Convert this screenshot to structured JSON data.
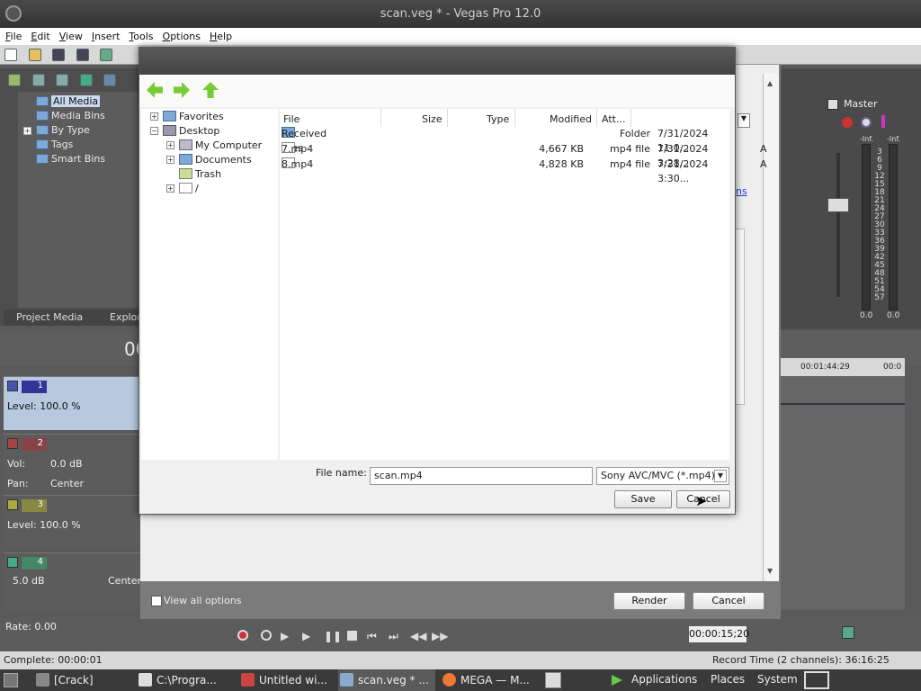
{
  "window": {
    "title": "scan.veg * - Vegas Pro 12.0"
  },
  "menu": [
    "File",
    "Edit",
    "View",
    "Insert",
    "Tools",
    "Options",
    "Help"
  ],
  "media_tree": [
    "All Media",
    "Media Bins",
    "By Type",
    "Tags",
    "Smart Bins"
  ],
  "media_tabs": [
    "Project Media",
    "Explorer"
  ],
  "master": {
    "label": "Master",
    "left_top": "-Inf.",
    "right_top": "-Inf.",
    "left_val": "0.0",
    "right_val": "0.0",
    "ticks": [
      "3",
      "6",
      "9",
      "12",
      "15",
      "18",
      "21",
      "24",
      "27",
      "30",
      "33",
      "36",
      "39",
      "42",
      "45",
      "48",
      "51",
      "54",
      "57"
    ]
  },
  "timeline": {
    "cursor_partial": "00",
    "ruler": [
      "00:01:44:29",
      "00:0"
    ]
  },
  "tracks": [
    {
      "num": "1",
      "line1": "Level: 100.0 %"
    },
    {
      "num": "2",
      "vol_label": "Vol:",
      "vol": "0.0 dB",
      "pan_label": "Pan:",
      "pan": "Center"
    },
    {
      "num": "3",
      "line1": "Level: 100.0 %"
    },
    {
      "num": "4",
      "vol": "5.0 dB",
      "pan": "Center"
    }
  ],
  "transport": {
    "rate": "Rate: 0.00",
    "time": "00:00:15;20"
  },
  "status": {
    "left": "Complete: 00:00:01",
    "right": "Record Time (2 channels): 36:16:25"
  },
  "taskbar": {
    "items": [
      "[Crack]",
      "C:\\Progra...",
      "Untitled wi...",
      "scan.veg * ...",
      "MEGA — M..."
    ],
    "menus": [
      "Applications",
      "Places",
      "System"
    ]
  },
  "render_dialog": {
    "view_all_label": "View all options",
    "render_button": "Render",
    "cancel_button": "Cancel",
    "link_partial": "ns"
  },
  "save_dialog": {
    "tree": [
      "Favorites",
      "Desktop",
      "My Computer",
      "Documents",
      "Trash",
      "/"
    ],
    "columns": {
      "file": "File",
      "size": "Size",
      "type": "Type",
      "modified": "Modified",
      "attr": "Att..."
    },
    "files": [
      {
        "name": "Received Files",
        "size": "",
        "type": "Folder",
        "modified": "7/31/2024 11:0...",
        "attr": "",
        "icon": "folder-icon"
      },
      {
        "name": "7.mp4",
        "size": "4,667 KB",
        "type": "mp4 file",
        "modified": "7/31/2024 3:28...",
        "attr": "A",
        "icon": "file-icon"
      },
      {
        "name": "8.mp4",
        "size": "4,828 KB",
        "type": "mp4 file",
        "modified": "7/31/2024 3:30...",
        "attr": "A",
        "icon": "file-icon"
      }
    ],
    "file_name_label": "File name:",
    "file_name_value": "scan.mp4",
    "file_type": "Sony AVC/MVC (*.mp4)",
    "save_button": "Save",
    "cancel_button": "Cancel"
  }
}
